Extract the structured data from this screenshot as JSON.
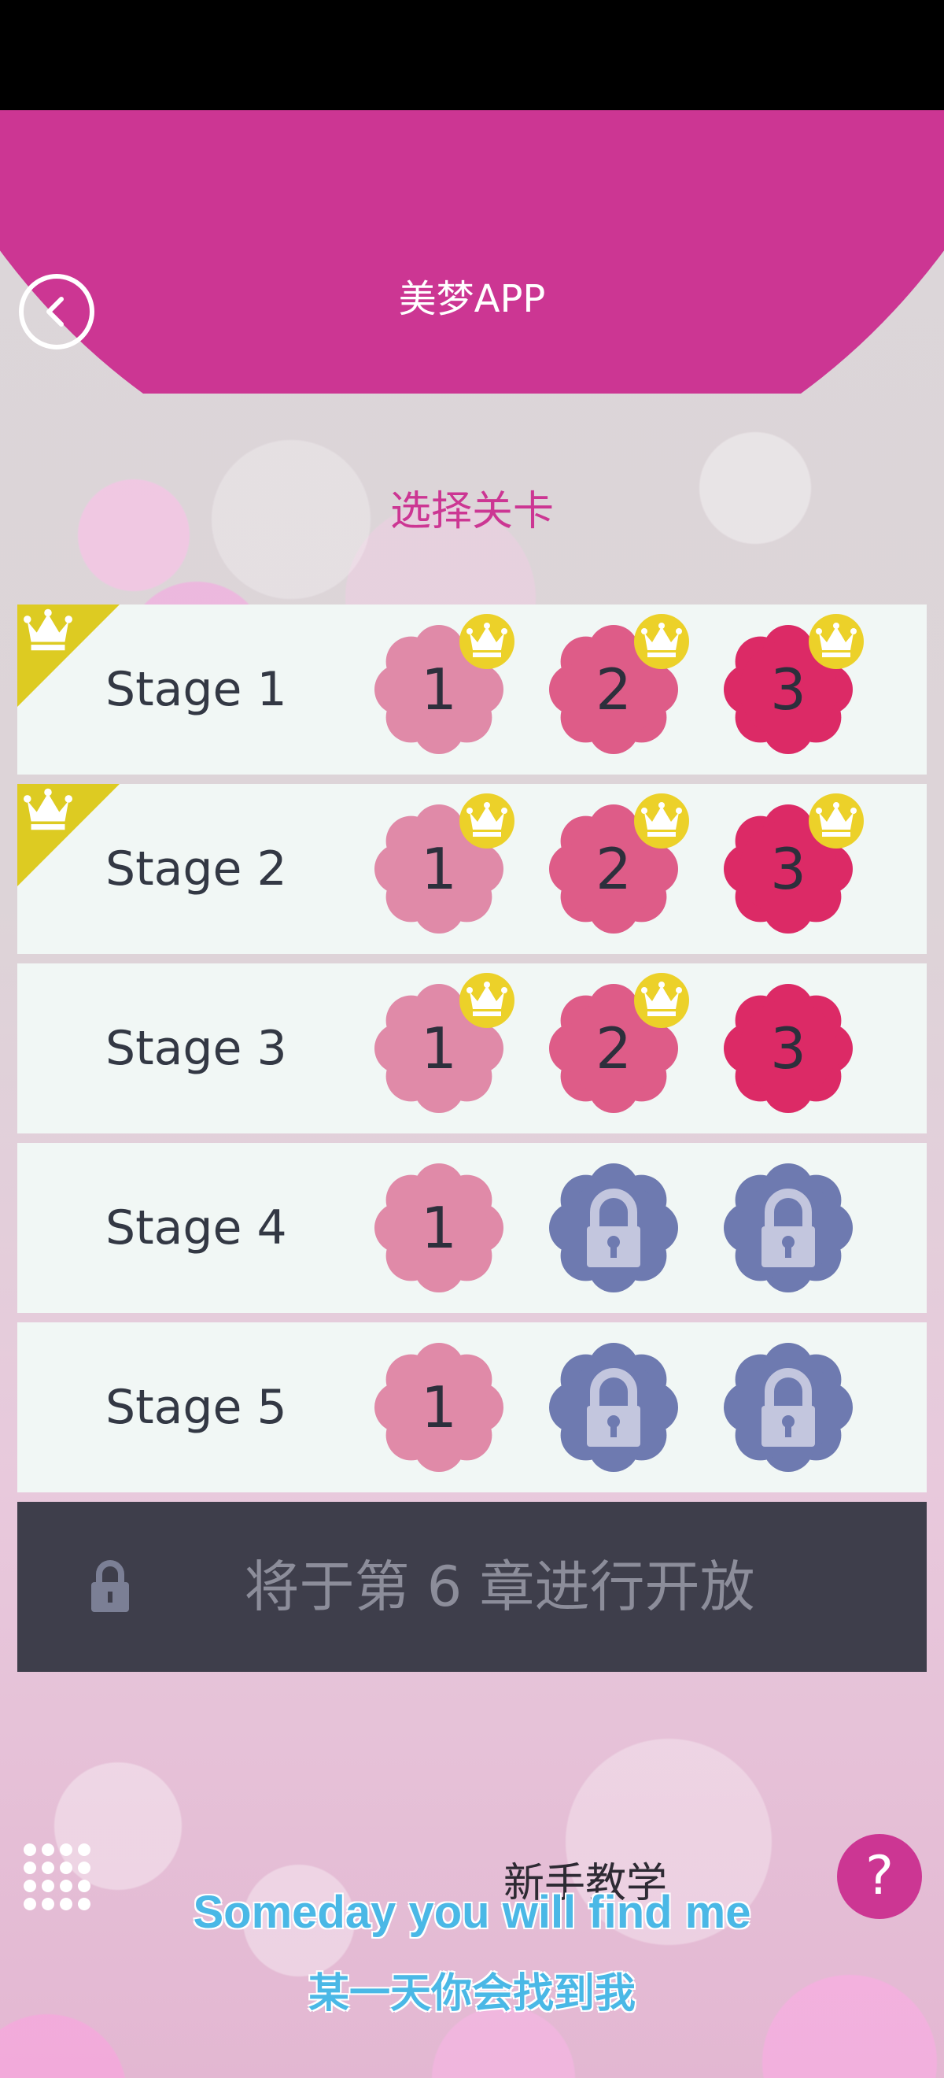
{
  "header": {
    "back_icon": "chevron-left-icon",
    "title": "美梦APP"
  },
  "section_title": "选择关卡",
  "colors": {
    "brand": "#cc3693",
    "level1": "#e08aa8",
    "level2": "#de5c88",
    "level3": "#dc2a66",
    "locked": "#6e7ab0",
    "crown": "#ecd129",
    "ribbon": "#ddcb22"
  },
  "stages": [
    {
      "label": "Stage 1",
      "completed_ribbon": true,
      "levels": [
        {
          "number": "1",
          "locked": false,
          "crowned": true
        },
        {
          "number": "2",
          "locked": false,
          "crowned": true
        },
        {
          "number": "3",
          "locked": false,
          "crowned": true
        }
      ]
    },
    {
      "label": "Stage 2",
      "completed_ribbon": true,
      "levels": [
        {
          "number": "1",
          "locked": false,
          "crowned": true
        },
        {
          "number": "2",
          "locked": false,
          "crowned": true
        },
        {
          "number": "3",
          "locked": false,
          "crowned": true
        }
      ]
    },
    {
      "label": "Stage 3",
      "completed_ribbon": false,
      "levels": [
        {
          "number": "1",
          "locked": false,
          "crowned": true
        },
        {
          "number": "2",
          "locked": false,
          "crowned": true
        },
        {
          "number": "3",
          "locked": false,
          "crowned": false
        }
      ]
    },
    {
      "label": "Stage 4",
      "completed_ribbon": false,
      "levels": [
        {
          "number": "1",
          "locked": false,
          "crowned": false
        },
        {
          "number": "",
          "locked": true,
          "crowned": false
        },
        {
          "number": "",
          "locked": true,
          "crowned": false
        }
      ]
    },
    {
      "label": "Stage 5",
      "completed_ribbon": false,
      "levels": [
        {
          "number": "1",
          "locked": false,
          "crowned": false
        },
        {
          "number": "",
          "locked": true,
          "crowned": false
        },
        {
          "number": "",
          "locked": true,
          "crowned": false
        }
      ]
    }
  ],
  "locked_chapter": {
    "icon": "lock-icon",
    "text": "将于第 6 章进行开放"
  },
  "footer": {
    "menu_icon": "grid-menu-icon",
    "tutorial_label": "新手教学",
    "help_label": "?"
  },
  "subtitles": {
    "english": "Someday you will find me",
    "chinese": "某一天你会找到我"
  }
}
